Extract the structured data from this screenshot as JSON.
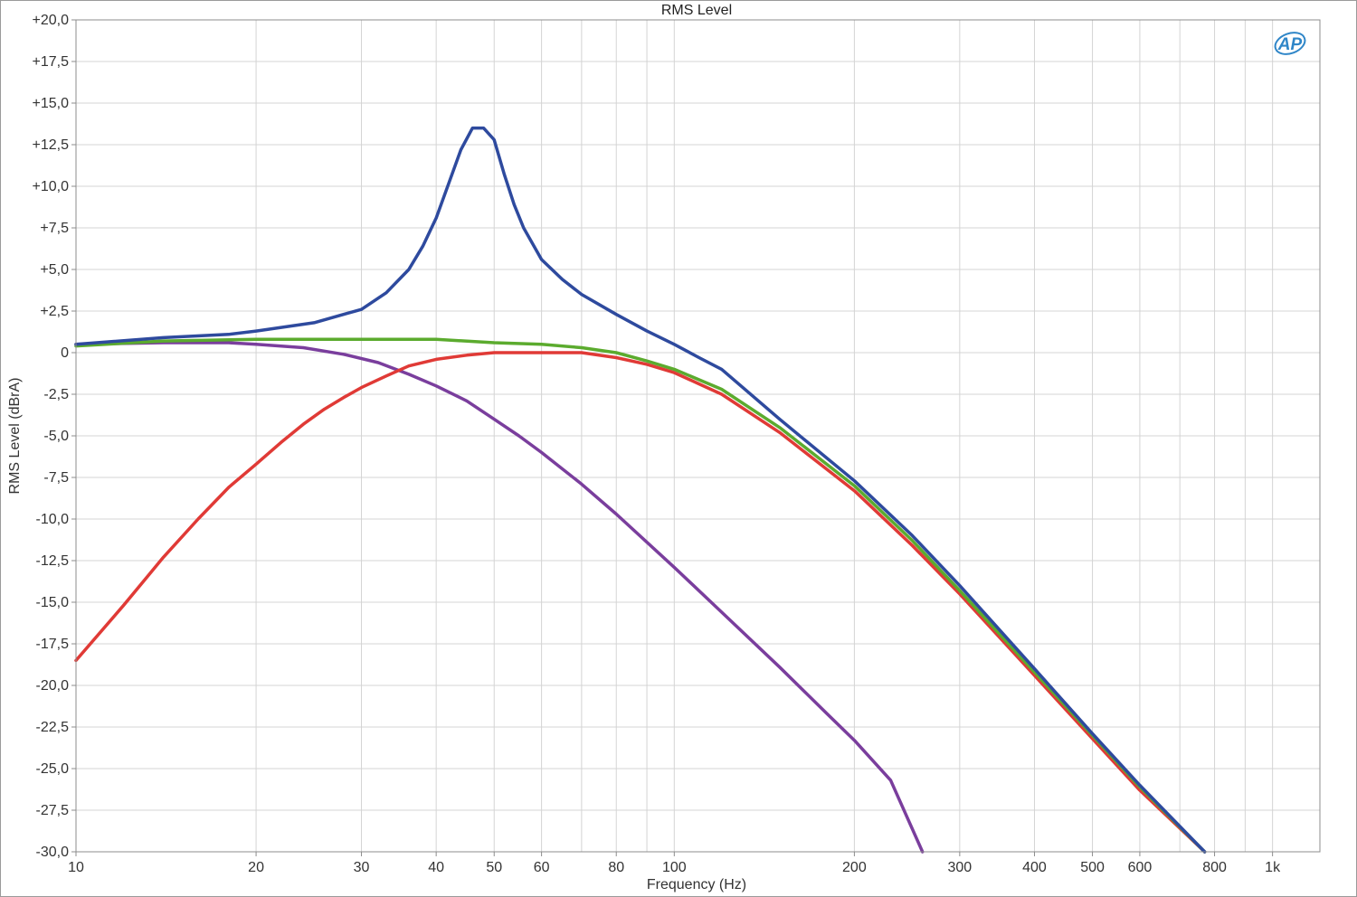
{
  "chart_data": {
    "type": "line",
    "title": "RMS Level",
    "xlabel": "Frequency (Hz)",
    "ylabel": "RMS Level (dBrA)",
    "x_scale": "log",
    "xlim": [
      10,
      1200
    ],
    "ylim": [
      -30,
      20
    ],
    "grid": true,
    "logo": "AP",
    "x_ticks": [
      {
        "value": 10,
        "label": "10"
      },
      {
        "value": 20,
        "label": "20"
      },
      {
        "value": 30,
        "label": "30"
      },
      {
        "value": 40,
        "label": "40"
      },
      {
        "value": 50,
        "label": "50"
      },
      {
        "value": 60,
        "label": "60"
      },
      {
        "value": 80,
        "label": "80"
      },
      {
        "value": 100,
        "label": "100"
      },
      {
        "value": 200,
        "label": "200"
      },
      {
        "value": 300,
        "label": "300"
      },
      {
        "value": 400,
        "label": "400"
      },
      {
        "value": 500,
        "label": "500"
      },
      {
        "value": 600,
        "label": "600"
      },
      {
        "value": 800,
        "label": "800"
      },
      {
        "value": 1000,
        "label": "1k"
      }
    ],
    "x_minor_grid": [
      70,
      90,
      700,
      900
    ],
    "y_ticks": [
      {
        "value": 20,
        "label": "+20,0"
      },
      {
        "value": 17.5,
        "label": "+17,5"
      },
      {
        "value": 15,
        "label": "+15,0"
      },
      {
        "value": 12.5,
        "label": "+12,5"
      },
      {
        "value": 10,
        "label": "+10,0"
      },
      {
        "value": 7.5,
        "label": "+7,5"
      },
      {
        "value": 5,
        "label": "+5,0"
      },
      {
        "value": 2.5,
        "label": "+2,5"
      },
      {
        "value": 0,
        "label": "0"
      },
      {
        "value": -2.5,
        "label": "-2,5"
      },
      {
        "value": -5,
        "label": "-5,0"
      },
      {
        "value": -7.5,
        "label": "-7,5"
      },
      {
        "value": -10,
        "label": "-10,0"
      },
      {
        "value": -12.5,
        "label": "-12,5"
      },
      {
        "value": -15,
        "label": "-15,0"
      },
      {
        "value": -17.5,
        "label": "-17,5"
      },
      {
        "value": -20,
        "label": "-20,0"
      },
      {
        "value": -22.5,
        "label": "-22,5"
      },
      {
        "value": -25,
        "label": "-25,0"
      },
      {
        "value": -27.5,
        "label": "-27,5"
      },
      {
        "value": -30,
        "label": "-30,0"
      }
    ],
    "series": [
      {
        "color": "#7a3e9d",
        "x": [
          10,
          14,
          18,
          20,
          24,
          28,
          32,
          36,
          40,
          45,
          50,
          55,
          60,
          70,
          80,
          100,
          120,
          150,
          180,
          200,
          230,
          260
        ],
        "y": [
          0.5,
          0.6,
          0.6,
          0.5,
          0.3,
          -0.1,
          -0.6,
          -1.3,
          -2.0,
          -2.9,
          -4.0,
          -5.0,
          -6.0,
          -7.9,
          -9.7,
          -12.9,
          -15.6,
          -18.9,
          -21.7,
          -23.3,
          -25.7,
          -30.0
        ]
      },
      {
        "color": "#e03a36",
        "x": [
          10,
          12,
          14,
          16,
          18,
          20,
          22,
          24,
          26,
          28,
          30,
          33,
          36,
          40,
          45,
          50,
          55,
          60,
          65,
          70,
          80,
          90,
          100,
          120,
          150,
          200,
          250,
          300,
          400,
          500,
          600,
          770
        ],
        "y": [
          -18.5,
          -15.2,
          -12.3,
          -10.0,
          -8.1,
          -6.7,
          -5.4,
          -4.3,
          -3.4,
          -2.7,
          -2.1,
          -1.4,
          -0.8,
          -0.4,
          -0.15,
          0.0,
          0.0,
          0.0,
          0.0,
          0.0,
          -0.3,
          -0.7,
          -1.2,
          -2.5,
          -4.8,
          -8.3,
          -11.6,
          -14.5,
          -19.4,
          -23.2,
          -26.3,
          -30.0
        ]
      },
      {
        "color": "#5bab2e",
        "x": [
          10,
          14,
          20,
          30,
          40,
          50,
          60,
          70,
          80,
          90,
          100,
          120,
          150,
          200,
          250,
          300,
          400,
          500,
          600,
          770
        ],
        "y": [
          0.4,
          0.7,
          0.8,
          0.8,
          0.8,
          0.6,
          0.5,
          0.3,
          0.0,
          -0.5,
          -1.0,
          -2.2,
          -4.5,
          -8.0,
          -11.3,
          -14.3,
          -19.2,
          -23.0,
          -26.1,
          -30.0
        ]
      },
      {
        "color": "#2e4a9e",
        "x": [
          10,
          14,
          18,
          20,
          25,
          28,
          30,
          33,
          36,
          38,
          40,
          42,
          44,
          46,
          48,
          50,
          52,
          54,
          56,
          60,
          65,
          70,
          80,
          90,
          100,
          110,
          120,
          150,
          200,
          250,
          300,
          400,
          500,
          600,
          770
        ],
        "y": [
          0.5,
          0.9,
          1.1,
          1.3,
          1.8,
          2.3,
          2.6,
          3.6,
          5.0,
          6.4,
          8.1,
          10.2,
          12.2,
          13.5,
          13.5,
          12.8,
          10.7,
          8.9,
          7.5,
          5.6,
          4.4,
          3.5,
          2.3,
          1.3,
          0.5,
          -0.3,
          -1.0,
          -4.0,
          -7.7,
          -11.0,
          -14.0,
          -19.0,
          -22.9,
          -26.0,
          -30.0
        ]
      }
    ]
  }
}
